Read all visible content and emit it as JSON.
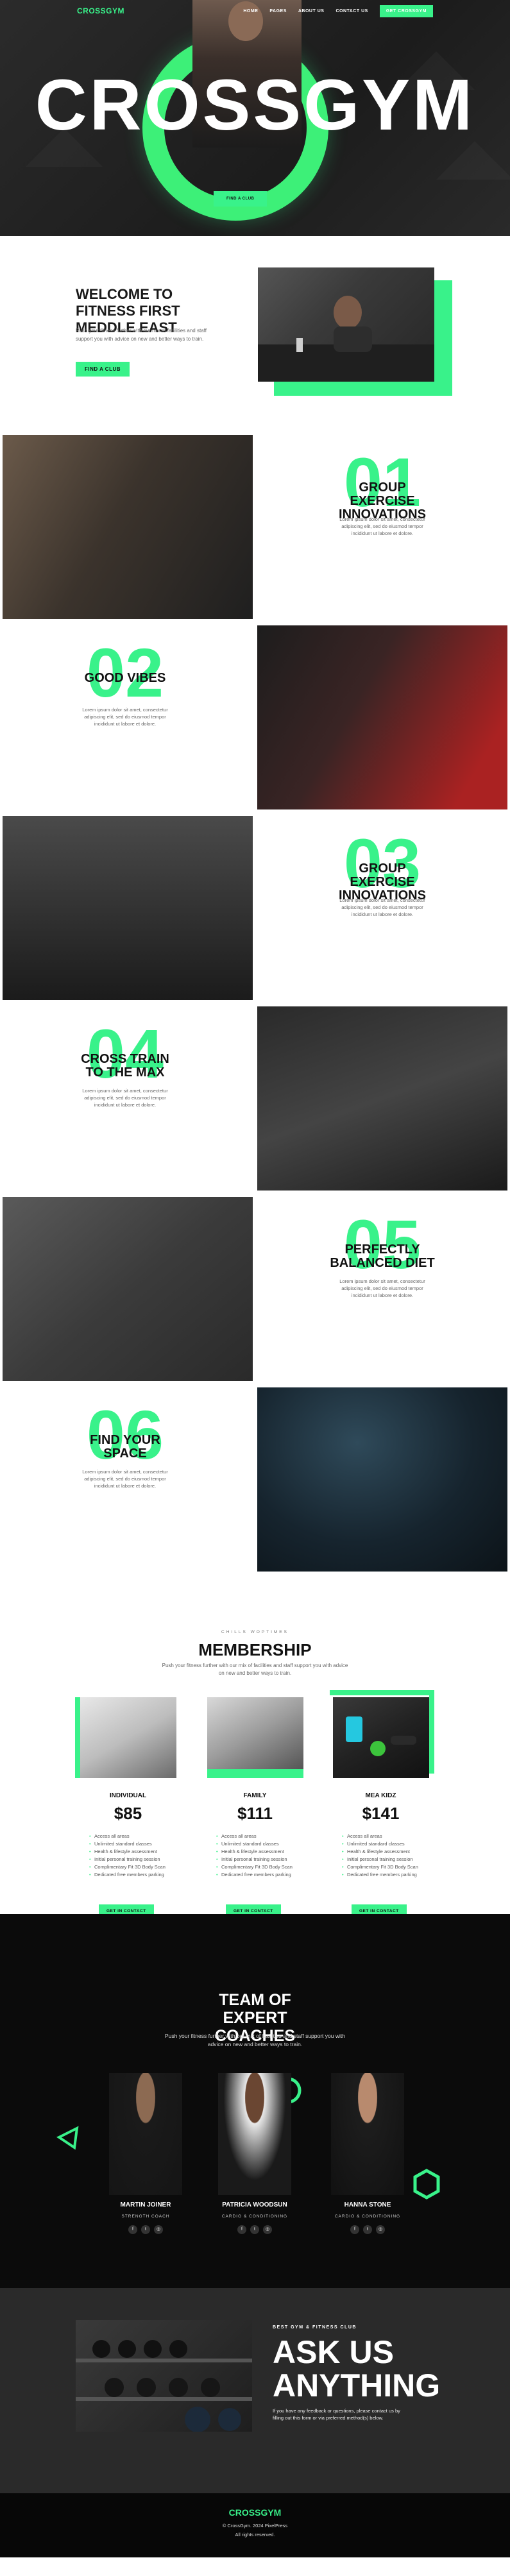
{
  "nav": {
    "logo": "CROSSGYM",
    "links": [
      "HOME",
      "PAGES",
      "ABOUT US",
      "CONTACT US"
    ],
    "cta": "GET CROSSGYM"
  },
  "hero": {
    "title": "CROSSGYM",
    "button": "FIND A CLUB"
  },
  "welcome": {
    "title": "WELCOME TO FITNESS FIRST MEDDLE EAST",
    "text": "Push your fitness further with our mix of facilities and staff support you with advice on new and better ways to train.",
    "button": "FIND A CLUB"
  },
  "features": [
    {
      "num": "01",
      "title": "GROUP EXERCISE INNOVATIONS",
      "text": "Lorem ipsum dolor sit amet, consectetur adipiscing elit, sed do eiusmod tempor incididunt ut labore et dolore."
    },
    {
      "num": "02",
      "title": "GOOD VIBES",
      "text": "Lorem ipsum dolor sit amet, consectetur adipiscing elit, sed do eiusmod tempor incididunt ut labore et dolore."
    },
    {
      "num": "03",
      "title": "GROUP EXERCISE INNOVATIONS",
      "text": "Lorem ipsum dolor sit amet, consectetur adipiscing elit, sed do eiusmod tempor incididunt ut labore et dolore."
    },
    {
      "num": "04",
      "title": "CROSS TRAIN TO THE MAX",
      "text": "Lorem ipsum dolor sit amet, consectetur adipiscing elit, sed do eiusmod tempor incididunt ut labore et dolore."
    },
    {
      "num": "05",
      "title": "PERFECTLY BALANCED DIET",
      "text": "Lorem ipsum dolor sit amet, consectetur adipiscing elit, sed do eiusmod tempor incididunt ut labore et dolore."
    },
    {
      "num": "06",
      "title": "FIND YOUR SPACE",
      "text": "Lorem ipsum dolor sit amet, consectetur adipiscing elit, sed do eiusmod tempor incididunt ut labore et dolore."
    }
  ],
  "membership": {
    "kicker": "CHILLS WOPTIMES",
    "title": "MEMBERSHIP",
    "text": "Push your fitness further with our mix of facilities and staff support you with advice on new and better ways to train.",
    "plans": [
      {
        "name": "INDIVIDUAL",
        "price": "$85",
        "features": [
          "Access all areas",
          "Unlimited standard classes",
          "Health & lifestyle assessment",
          "Initial personal training session",
          "Complimentary Fit 3D Body Scan",
          "Dedicated free members parking"
        ],
        "button": "GET IN CONTACT"
      },
      {
        "name": "FAMILY",
        "price": "$111",
        "features": [
          "Access all areas",
          "Unlimited standard classes",
          "Health & lifestyle assessment",
          "Initial personal training session",
          "Complimentary Fit 3D Body Scan",
          "Dedicated free members parking"
        ],
        "button": "GET IN CONTACT"
      },
      {
        "name": "MEA KIDZ",
        "price": "$141",
        "features": [
          "Access all areas",
          "Unlimited standard classes",
          "Health & lifestyle assessment",
          "Initial personal training session",
          "Complimentary Fit 3D Body Scan",
          "Dedicated free members parking"
        ],
        "button": "GET IN CONTACT"
      }
    ]
  },
  "coaches": {
    "title": "TEAM OF EXPERT COACHES",
    "text": "Push your fitness further with our mix of facilities and staff support you with advice on new and better ways to train.",
    "list": [
      {
        "name": "MARTIN JOINER",
        "role": "STRENGTH COACH"
      },
      {
        "name": "PATRICIA WOODSUN",
        "role": "CARDIO & CONDITIONING"
      },
      {
        "name": "HANNA STONE",
        "role": "CARDIO & CONDITIONING"
      }
    ]
  },
  "ask": {
    "kicker": "BEST GYM & FITNESS CLUB",
    "title": "ASK US ANYTHING",
    "text": "If you have any feedback or questions, please contact us by filling out this form or via preferred method(s) below."
  },
  "footer": {
    "logo": "CROSSGYM",
    "copy": "© CrossGym. 2024 PixelPress",
    "rights": "All rights reserved."
  },
  "colors": {
    "accent": "#39f28a",
    "dark": "#0b0b0b",
    "hero": "#222222"
  }
}
